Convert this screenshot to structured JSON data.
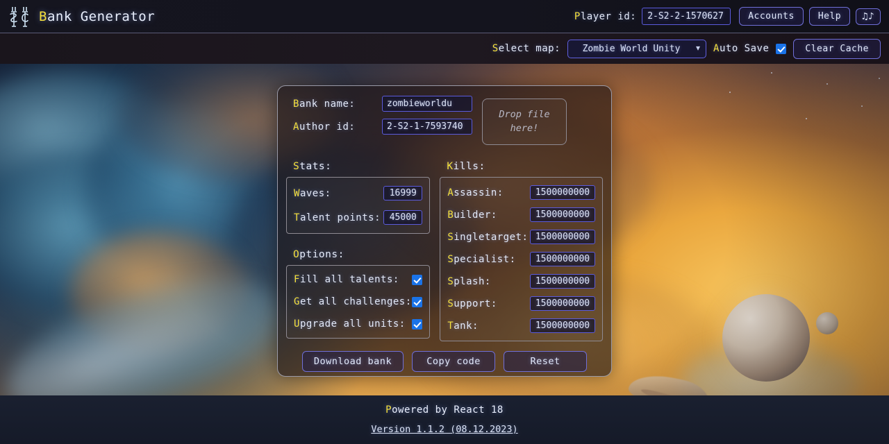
{
  "header": {
    "logo_icon": "crossed-swords-sc-logo-icon",
    "title_highlight": "B",
    "title_rest": "ank Generator",
    "player_id_label_highlight": "P",
    "player_id_label_rest": "layer id:",
    "player_id_value": "2-S2-2-1570627",
    "accounts_label": "Accounts",
    "help_label": "Help",
    "music_icon": "♫♪"
  },
  "subheader": {
    "select_map_label_highlight": "S",
    "select_map_label_rest": "elect map:",
    "selected_map": "Zombie World Unity",
    "map_options": [
      "Zombie World Unity"
    ],
    "auto_save_label_highlight": "A",
    "auto_save_label_rest": "uto Save",
    "auto_save_checked": true,
    "clear_cache_label": "Clear Cache"
  },
  "panel": {
    "bank_name_label_highlight": "B",
    "bank_name_label_rest": "ank name:",
    "bank_name_value": "zombieworldu",
    "author_id_label_highlight": "A",
    "author_id_label_rest": "uthor id:",
    "author_id_value": "2-S2-1-7593740",
    "dropzone_line1": "Drop file",
    "dropzone_line2": "here!",
    "stats_title_highlight": "S",
    "stats_title_rest": "tats:",
    "kills_title_highlight": "K",
    "kills_title_rest": "ills:",
    "options_title_highlight": "O",
    "options_title_rest": "ptions:",
    "stats": [
      {
        "label_highlight": "W",
        "label_rest": "aves:",
        "value": "16999"
      },
      {
        "label_highlight": "T",
        "label_rest": "alent points:",
        "value": "45000"
      }
    ],
    "options": [
      {
        "label_highlight": "F",
        "label_rest": "ill all talents:",
        "checked": true
      },
      {
        "label_highlight": "G",
        "label_rest": "et all challenges:",
        "checked": true
      },
      {
        "label_highlight": "U",
        "label_rest": "pgrade all units:",
        "checked": true
      }
    ],
    "kills": [
      {
        "label_highlight": "A",
        "label_rest": "ssassin:",
        "value": "1500000000"
      },
      {
        "label_highlight": "B",
        "label_rest": "uilder:",
        "value": "1500000000"
      },
      {
        "label_highlight": "S",
        "label_rest": "ingletarget:",
        "value": "1500000000"
      },
      {
        "label_highlight": "S",
        "label_rest": "pecialist:",
        "value": "1500000000"
      },
      {
        "label_highlight": "S",
        "label_rest": "plash:",
        "value": "1500000000"
      },
      {
        "label_highlight": "S",
        "label_rest": "upport:",
        "value": "1500000000"
      },
      {
        "label_highlight": "T",
        "label_rest": "ank:",
        "value": "1500000000"
      }
    ],
    "download_label": "Download bank",
    "copy_label": "Copy code",
    "reset_label": "Reset"
  },
  "footer": {
    "powered_highlight": "P",
    "powered_rest": "owered by React 18",
    "version_link": "Version 1.1.2 (08.12.2023)"
  },
  "colors": {
    "accent_yellow": "#f5e03c",
    "text_light": "#e6ecfb",
    "input_border": "#5b5bdd",
    "checkbox_blue": "#1a73e8"
  }
}
